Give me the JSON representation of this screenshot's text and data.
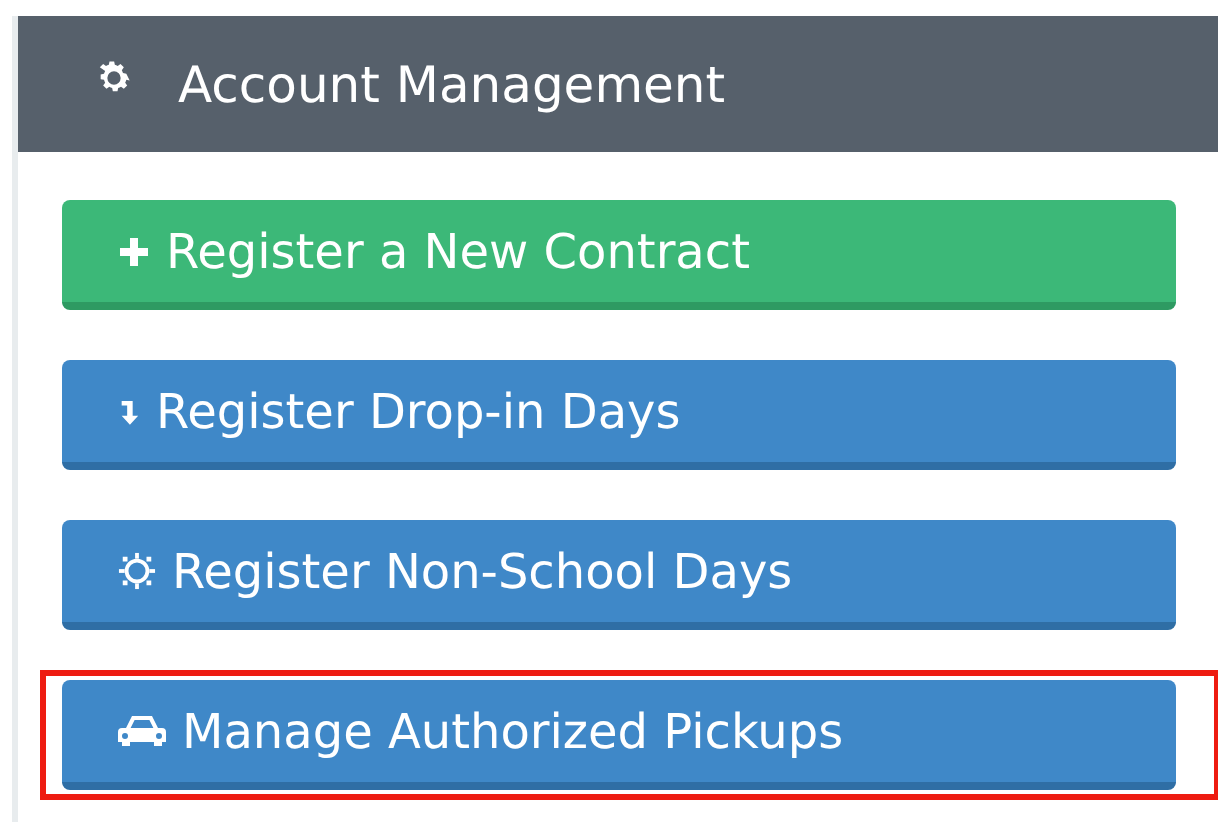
{
  "panel": {
    "title": "Account Management"
  },
  "buttons": [
    {
      "label": "Register a New Contract",
      "kind": "add",
      "highlighted": false
    },
    {
      "label": "Register Drop-in Days",
      "kind": "dropin",
      "highlighted": false
    },
    {
      "label": "Register Non-School Days",
      "kind": "nonschool",
      "highlighted": false
    },
    {
      "label": "Manage Authorized Pickups",
      "kind": "pickup",
      "highlighted": true
    }
  ]
}
